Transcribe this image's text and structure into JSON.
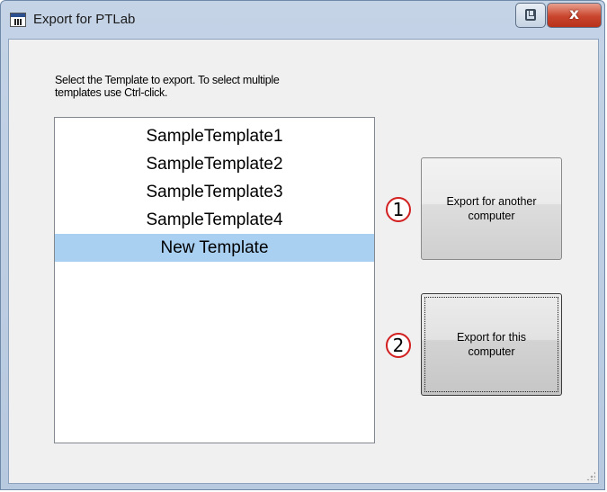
{
  "window": {
    "title": "Export for PTLab",
    "controls": {
      "restore_icon": "restore-icon",
      "close_glyph": "x"
    }
  },
  "instructions": "Select the Template to export.  To select multiple\ntemplates use Ctrl-click.",
  "template_list": {
    "items": [
      {
        "label": "SampleTemplate1",
        "selected": false
      },
      {
        "label": "SampleTemplate2",
        "selected": false
      },
      {
        "label": "SampleTemplate3",
        "selected": false
      },
      {
        "label": "SampleTemplate4",
        "selected": false
      },
      {
        "label": "New Template",
        "selected": true
      }
    ]
  },
  "buttons": {
    "export_other": {
      "label": "Export for another computer",
      "badge": "1"
    },
    "export_this": {
      "label": "Export for this computer",
      "badge": "2"
    }
  },
  "colors": {
    "selection": "#a9cff1",
    "badge_border": "#d21f1f",
    "close_button": "#c9452d"
  }
}
